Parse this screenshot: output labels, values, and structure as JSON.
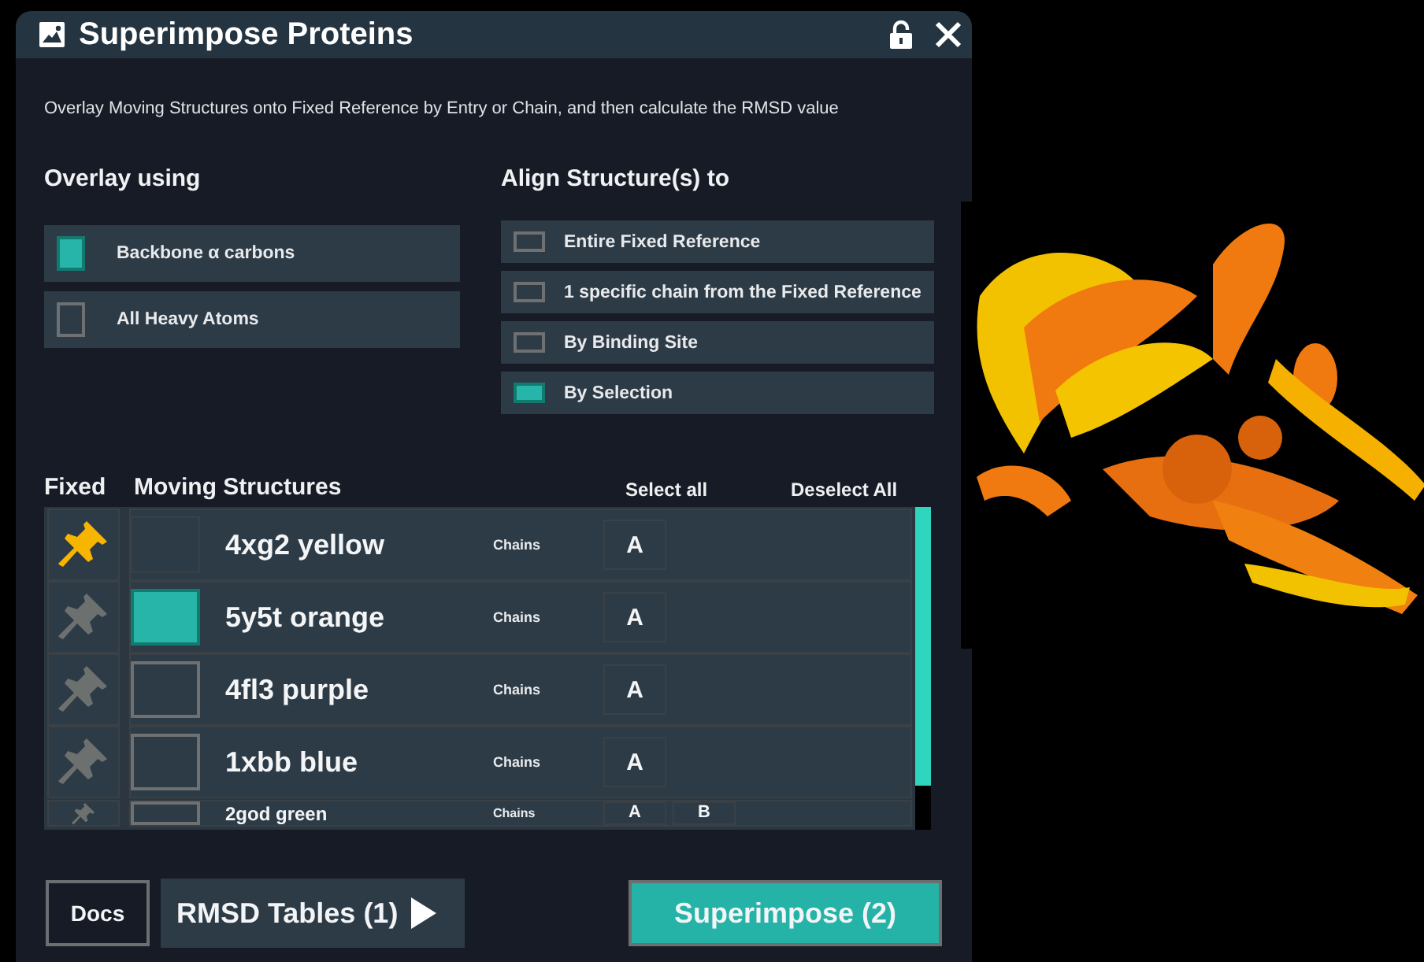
{
  "window": {
    "title": "Superimpose Proteins"
  },
  "description": "Overlay Moving Structures onto Fixed Reference by Entry or Chain, and then calculate the RMSD value",
  "overlay": {
    "heading": "Overlay using",
    "options": [
      {
        "label": "Backbone α carbons",
        "selected": true
      },
      {
        "label": "All Heavy Atoms",
        "selected": false
      }
    ]
  },
  "align": {
    "heading": "Align Structure(s) to",
    "options": [
      {
        "label": "Entire Fixed Reference",
        "selected": false
      },
      {
        "label": "1 specific chain from the Fixed Reference",
        "selected": false
      },
      {
        "label": "By Binding Site",
        "selected": false
      },
      {
        "label": "By Selection",
        "selected": true
      }
    ]
  },
  "structures": {
    "fixed_heading": "Fixed",
    "moving_heading": "Moving Structures",
    "select_all": "Select all",
    "deselect_all": "Deselect All",
    "rows": [
      {
        "name": "4xg2 yellow",
        "fixed": true,
        "checked": false,
        "chains_label": "Chains",
        "chains": [
          "A"
        ]
      },
      {
        "name": "5y5t orange",
        "fixed": false,
        "checked": true,
        "chains_label": "Chains",
        "chains": [
          "A"
        ]
      },
      {
        "name": "4fl3 purple",
        "fixed": false,
        "checked": false,
        "chains_label": "Chains",
        "chains": [
          "A"
        ]
      },
      {
        "name": "1xbb blue",
        "fixed": false,
        "checked": false,
        "chains_label": "Chains",
        "chains": [
          "A"
        ]
      },
      {
        "name": "2god green",
        "fixed": false,
        "checked": false,
        "chains_label": "Chains",
        "chains": [
          "A",
          "B"
        ]
      }
    ]
  },
  "buttons": {
    "docs": "Docs",
    "tables": "RMSD Tables (1)",
    "superimpose": "Superimpose (2)"
  }
}
